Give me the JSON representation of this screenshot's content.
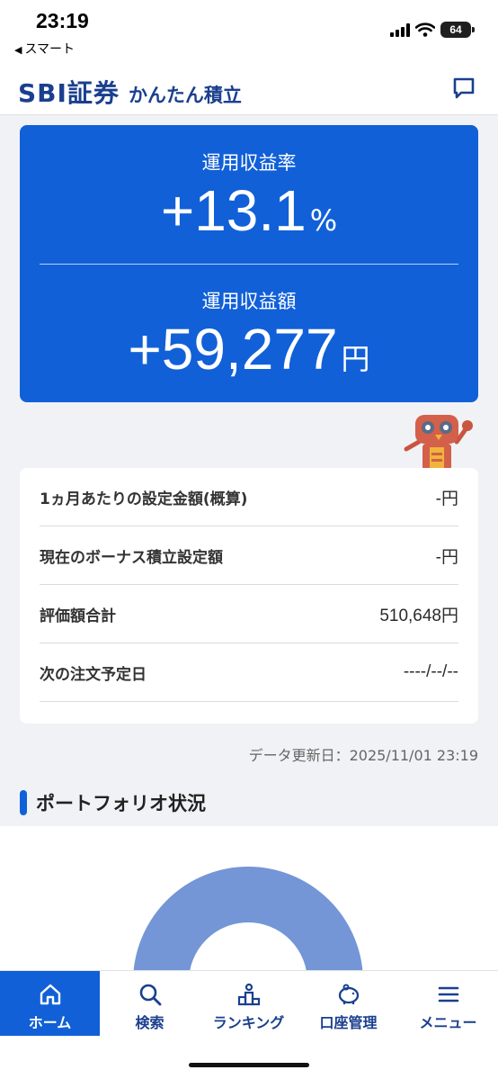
{
  "status": {
    "time": "23:19",
    "back_label": "スマート",
    "battery": "64"
  },
  "header": {
    "brand": "SBI証券",
    "subtitle": "かんたん積立",
    "chat_icon": "chat-bubble-icon"
  },
  "summary": {
    "rate_label": "運用収益率",
    "rate_value": "+13.1",
    "rate_unit": "%",
    "amount_label": "運用収益額",
    "amount_value": "+59,277",
    "amount_unit": "円"
  },
  "info": {
    "rows": [
      {
        "label": "1ヵ月あたりの設定金額(概算)",
        "value": "-円"
      },
      {
        "label": "現在のボーナス積立設定額",
        "value": "-円"
      },
      {
        "label": "評価額合計",
        "value": "510,648円"
      },
      {
        "label": "次の注文予定日",
        "value": "----/--/--"
      }
    ]
  },
  "updated": "データ更新日：2025/11/01 23:19",
  "portfolio": {
    "title": "ポートフォリオ状況"
  },
  "nav": {
    "items": [
      {
        "label": "ホーム",
        "icon": "home-icon"
      },
      {
        "label": "検索",
        "icon": "search-icon"
      },
      {
        "label": "ランキング",
        "icon": "ranking-icon"
      },
      {
        "label": "口座管理",
        "icon": "piggy-bank-icon"
      },
      {
        "label": "メニュー",
        "icon": "menu-icon"
      }
    ]
  },
  "colors": {
    "accent": "#1160d8",
    "brand": "#1a3f8f",
    "donut": "#7496d6"
  }
}
